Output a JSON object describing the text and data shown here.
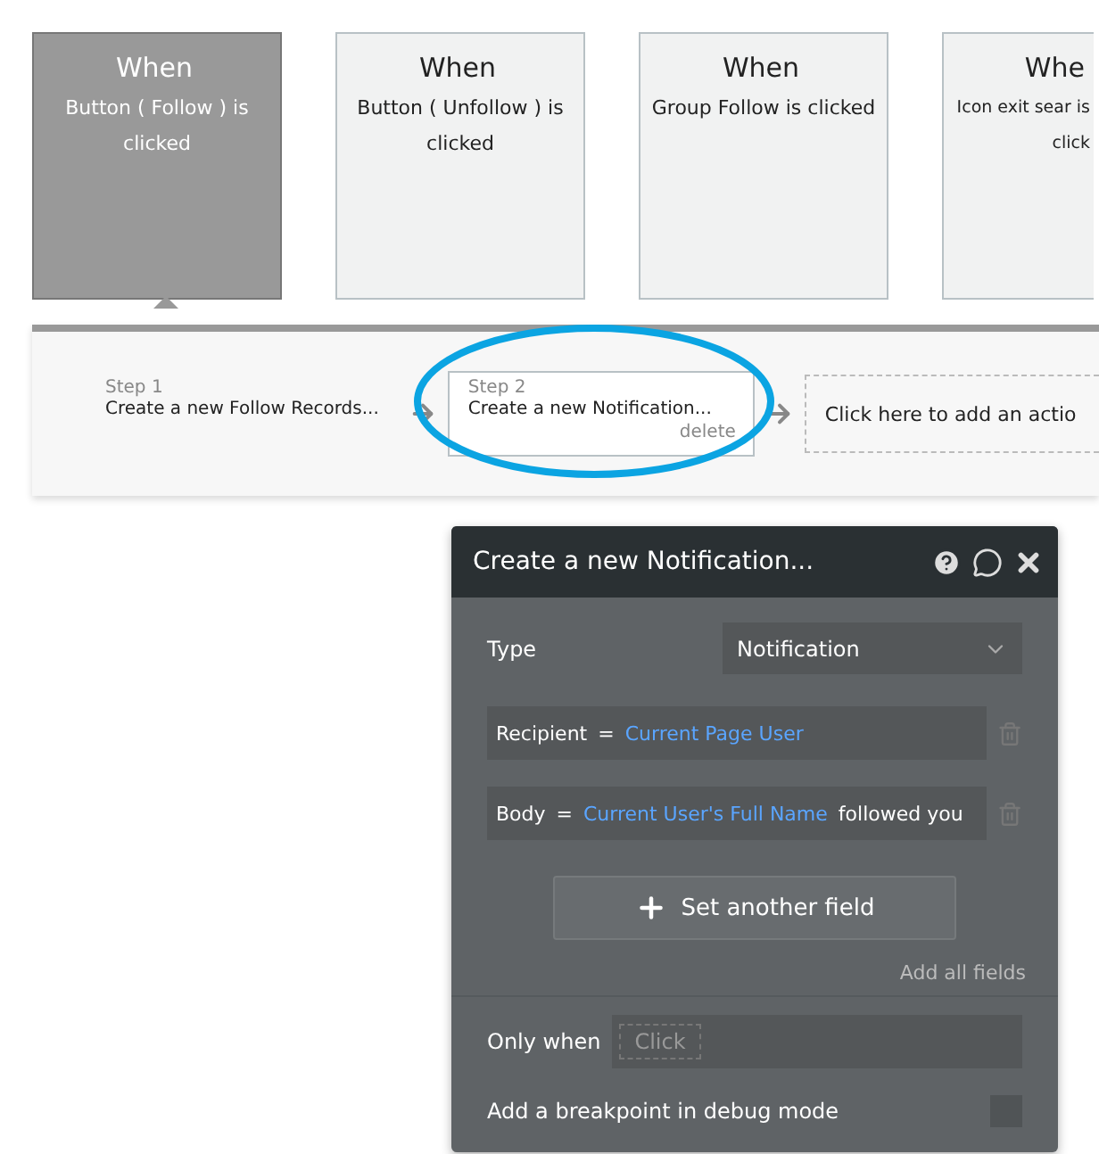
{
  "events": [
    {
      "title": "When",
      "description": "Button ( Follow ) is clicked",
      "selected": true
    },
    {
      "title": "When",
      "description": "Button ( Unfollow ) is clicked",
      "selected": false
    },
    {
      "title": "When",
      "description": "Group Follow is clicked",
      "selected": false
    },
    {
      "title": "Whe",
      "description": "Icon exit sear is click",
      "selected": false
    }
  ],
  "workflow": {
    "steps": [
      {
        "label": "Step 1",
        "title": "Create a new Follow Records...",
        "selected": false
      },
      {
        "label": "Step 2",
        "title": "Create a new Notification...",
        "selected": true,
        "delete": "delete"
      }
    ],
    "add_action": "Click here to add an actio"
  },
  "panel": {
    "title": "Create a new Notification...",
    "type_label": "Type",
    "type_value": "Notification",
    "fields": [
      {
        "name": "Recipient",
        "operator": "=",
        "parts": [
          {
            "kind": "dynamic",
            "text": "Current Page User"
          }
        ]
      },
      {
        "name": "Body",
        "operator": "=",
        "parts": [
          {
            "kind": "dynamic",
            "text": "Current User's Full Name"
          },
          {
            "kind": "static",
            "text": "followed you"
          }
        ]
      }
    ],
    "set_field_button": "Set another field",
    "add_all": "Add all fields",
    "only_when_label": "Only when",
    "only_when_placeholder": "Click",
    "breakpoint_label": "Add a breakpoint in debug mode",
    "breakpoint_checked": false
  }
}
